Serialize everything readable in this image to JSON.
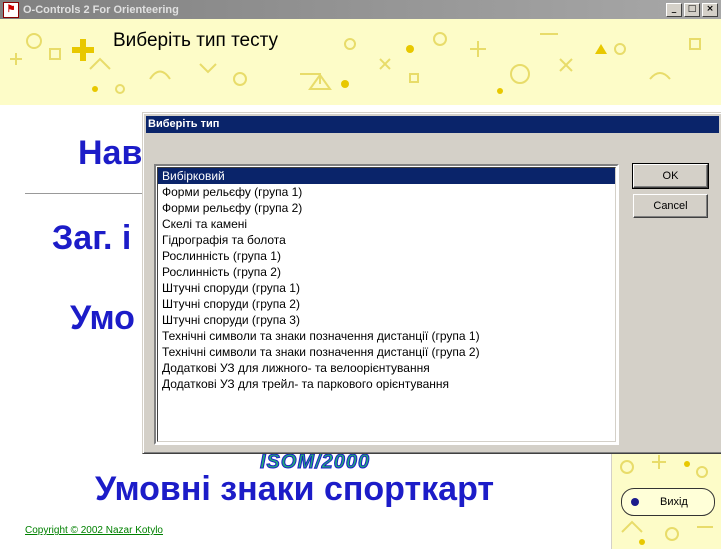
{
  "window": {
    "title": "O-Controls 2 For Orienteering",
    "minimize_label": "_",
    "maximize_label": "□",
    "close_label": "×"
  },
  "header": {
    "text": "Виберіть тип  тесту"
  },
  "main": {
    "nav_text": "Нав",
    "general_text": "Заг. і",
    "symbols_text": "Умо",
    "isom_text": "ISOM/2000",
    "big_title": "Умовні знаки спорткарт",
    "copyright": "Copyright © 2002 Nazar Kotylo",
    "exit_label": "Вихід"
  },
  "dialog": {
    "title": "Виберіть тип",
    "ok_label": "OK",
    "cancel_label": "Cancel",
    "selected_index": 0,
    "items": [
      "Вибірковий",
      "Форми рельєфу (група 1)",
      "Форми рельєфу (група 2)",
      "Скелі та камені",
      "Гідрографія та болота",
      "Рослинність (група 1)",
      "Рослинність (група 2)",
      "Штучні споруди (група 1)",
      "Штучні споруди (група 2)",
      "Штучні споруди (група 3)",
      "Технічні символи та знаки позначення дистанції (група 1)",
      "Технічні символи та знаки позначення дистанції (група 2)",
      "Додаткові УЗ для лижного- та велоорієнтування",
      "Додаткові УЗ для трейл- та паркового орієнтування"
    ]
  },
  "colors": {
    "header_bg": "#fdfcc8",
    "deco_yellow": "#f0e68c",
    "big_text_blue": "#1c1cc8",
    "selection_blue": "#0a246a",
    "copyright_green": "#008000"
  }
}
